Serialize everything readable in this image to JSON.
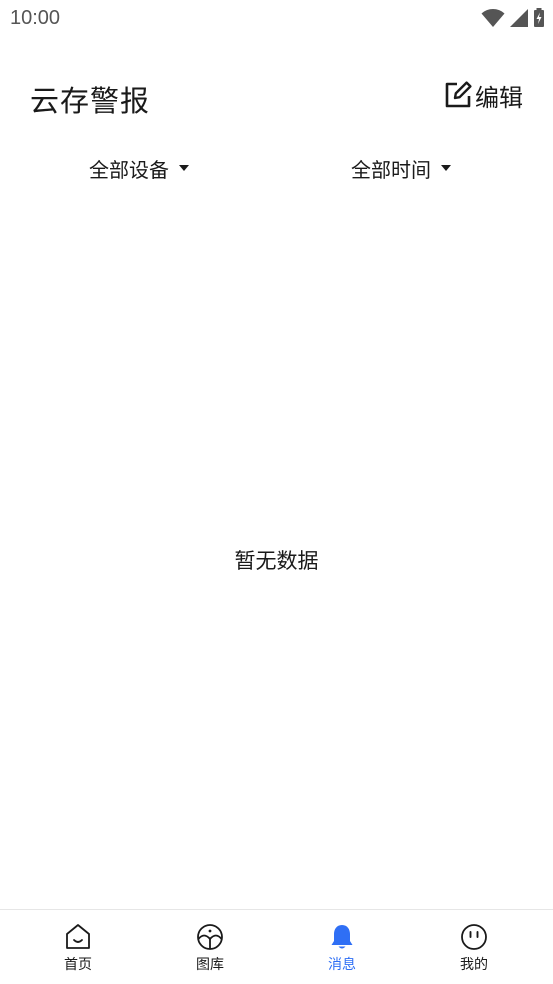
{
  "status_bar": {
    "time": "10:00",
    "icons": [
      "wifi-icon",
      "cell-signal-icon",
      "battery-charging-icon"
    ]
  },
  "header": {
    "title": "云存警报",
    "edit_label": "编辑",
    "edit_icon": "edit-icon"
  },
  "filters": {
    "device_label": "全部设备",
    "time_label": "全部时间"
  },
  "empty_state": {
    "text": "暂无数据"
  },
  "bottom_nav": {
    "items": [
      {
        "label": "首页",
        "icon": "home-icon",
        "active": false
      },
      {
        "label": "图库",
        "icon": "gallery-icon",
        "active": false
      },
      {
        "label": "消息",
        "icon": "bell-icon",
        "active": true
      },
      {
        "label": "我的",
        "icon": "profile-icon",
        "active": false
      }
    ]
  },
  "colors": {
    "accent": "#2f6ff5",
    "text": "#1a1a1a",
    "status_text": "#555555",
    "divider": "#e6e6e6"
  }
}
